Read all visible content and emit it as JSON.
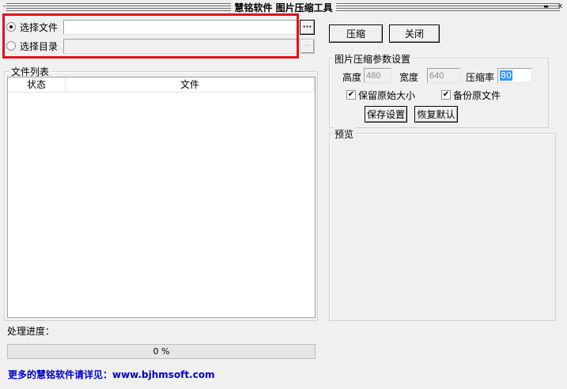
{
  "window": {
    "title": "慧铭软件 图片压缩工具",
    "menu_glyph": "-",
    "minimize_glyph": "▬",
    "close_glyph": "x"
  },
  "source": {
    "file_option_label": "选择文件",
    "file_option_checked": true,
    "file_path_value": "",
    "dir_option_label": "选择目录",
    "dir_option_checked": false,
    "dir_path_value": "",
    "browse_label": "···"
  },
  "file_list": {
    "group_label": "文件列表",
    "columns": [
      "状态",
      "文件"
    ],
    "rows": []
  },
  "actions": {
    "compress_label": "压缩",
    "close_label": "关闭"
  },
  "settings": {
    "group_label": "图片压缩参数设置",
    "height_label": "高度",
    "height_value": "480",
    "width_label": "宽度",
    "width_value": "640",
    "ratio_label": "压缩率",
    "ratio_value": "80",
    "keep_size_label": "保留原始大小",
    "keep_size_checked": true,
    "backup_label": "备份原文件",
    "backup_checked": true,
    "save_label": "保存设置",
    "restore_label": "恢复默认"
  },
  "preview": {
    "group_label": "预览"
  },
  "progress": {
    "label": "处理进度：",
    "value_text": "0 %",
    "fraction": 0
  },
  "footer": {
    "link_text": "更多的慧铭软件请详见：www.bjhmsoft.com"
  },
  "colors": {
    "highlight": "#e2101a",
    "link": "#0000d0",
    "selection": "#3399ff"
  },
  "icons": {
    "check": "✔"
  }
}
